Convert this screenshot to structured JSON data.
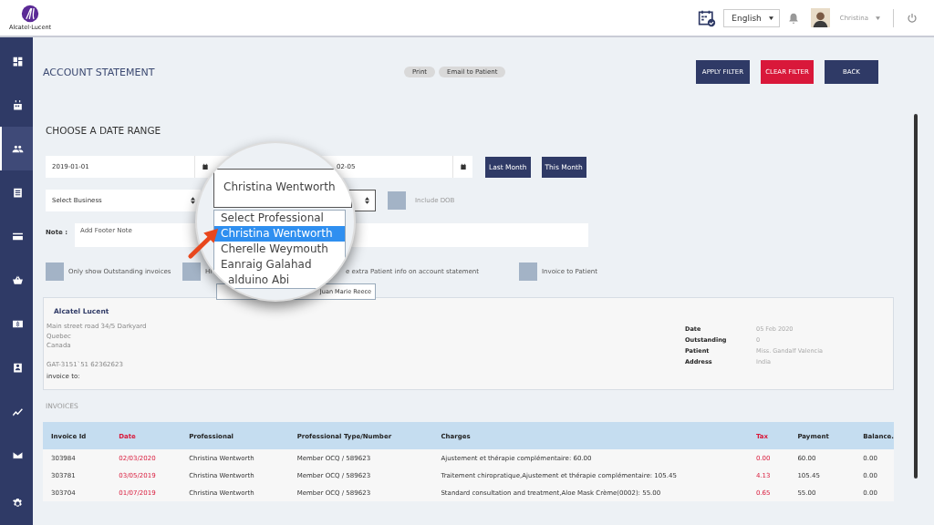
{
  "header": {
    "logo_text": "Alcatel·Lucent",
    "language": "English",
    "user": "Christina"
  },
  "sidebar": {
    "items": [
      {
        "kind": "dashboard",
        "selected": false
      },
      {
        "kind": "calendar",
        "selected": false
      },
      {
        "kind": "people",
        "selected": true
      },
      {
        "kind": "document",
        "selected": false
      },
      {
        "kind": "card",
        "selected": false
      },
      {
        "kind": "basket",
        "selected": false
      },
      {
        "kind": "dollar",
        "selected": false
      },
      {
        "kind": "contact",
        "selected": false
      },
      {
        "kind": "chart",
        "selected": false
      },
      {
        "kind": "mail",
        "selected": false
      },
      {
        "kind": "gear",
        "selected": false
      }
    ]
  },
  "page_title": "ACCOUNT STATEMENT",
  "actions": [
    "Print",
    "Email to Patient"
  ],
  "buttons": [
    {
      "label": "APPLY FILTER",
      "kind": "primary"
    },
    {
      "label": "CLEAR FILTER",
      "kind": "danger"
    },
    {
      "label": "BACK",
      "kind": "primary"
    }
  ],
  "filters": {
    "section_title": "CHOOSE A DATE RANGE",
    "date_from": "2019-01-01",
    "date_to": "02-05",
    "range_buttons": [
      "Last Month",
      "This Month"
    ],
    "business_placeholder": "Select Business",
    "include_dob": {
      "label": "Include DOB",
      "checked": false
    },
    "note": {
      "label": "Note :",
      "placeholder": "Add Footer Note"
    },
    "checkboxes": [
      {
        "kind": "checkbox",
        "label": "Only show Outstanding invoices",
        "checked": false
      },
      {
        "kind": "checkbox",
        "label": "Hi",
        "checked": false
      },
      {
        "kind": "text",
        "label": "e extra Patient info on account statement"
      },
      {
        "kind": "checkbox",
        "label": "Invoice to Patient",
        "checked": false
      }
    ]
  },
  "magnifier": {
    "select_value": "Christina Wentworth",
    "options": [
      {
        "label": "Select Professional",
        "selected": false
      },
      {
        "label": "Christina Wentworth",
        "selected": true
      },
      {
        "label": "Cherelle Weymouth",
        "selected": false
      },
      {
        "label": "Eanraig Galahad",
        "selected": false
      },
      {
        "label": "alduino Abi",
        "selected": false
      }
    ],
    "list_tail": "Juan Marie Reece"
  },
  "statement": {
    "company": "Alcatel Lucent",
    "address_lines": [
      "Main street road 34/5 Darkyard",
      "Quebec",
      "Canada"
    ],
    "tax_id": "GAT-3151`51 62362623",
    "invoice_to": "invoice to:",
    "details": [
      {
        "label": "Date",
        "value": "05 Feb 2020"
      },
      {
        "label": "Outstanding",
        "value": "0"
      },
      {
        "label": "Patient",
        "value": "Miss. Gandalf Valencia"
      },
      {
        "label": "Address",
        "value": "India"
      }
    ]
  },
  "invoices": {
    "title": "INVOICES",
    "columns": [
      {
        "label": "Invoice Id",
        "accent": false
      },
      {
        "label": "Date",
        "accent": true
      },
      {
        "label": "Professional",
        "accent": false
      },
      {
        "label": "Professional Type/Number",
        "accent": false
      },
      {
        "label": "Charges",
        "accent": false
      },
      {
        "label": "Tax",
        "accent": true
      },
      {
        "label": "Payment",
        "accent": false
      },
      {
        "label": "Balance.",
        "accent": false
      }
    ],
    "rows": [
      [
        "303984",
        "02/03/2020",
        "Christina Wentworth",
        "Member OCQ / 589623",
        "Ajustement et thérapie complémentaire: 60.00",
        "0.00",
        "60.00",
        "0.00"
      ],
      [
        "303781",
        "03/05/2019",
        "Christina Wentworth",
        "Member OCQ / 589623",
        "Traitement chiropratique,Ajustement et thérapie complémentaire: 105.45",
        "4.13",
        "105.45",
        "0.00"
      ],
      [
        "303704",
        "01/07/2019",
        "Christina Wentworth",
        "Member OCQ / 589623",
        "Standard consultation and treatment,Aloe Mask Crème(0002): 55.00",
        "0.65",
        "55.00",
        "0.00"
      ]
    ]
  }
}
